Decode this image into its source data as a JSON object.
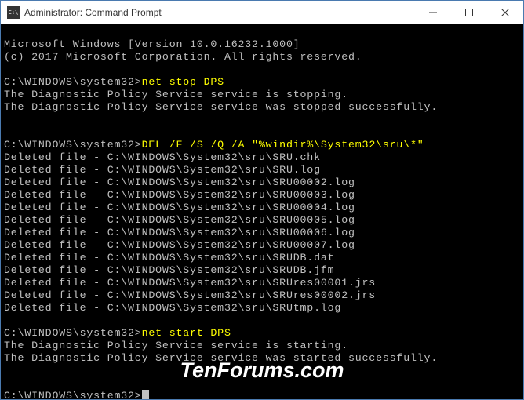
{
  "window": {
    "title": "Administrator: Command Prompt"
  },
  "console": {
    "header1": "Microsoft Windows [Version 10.0.16232.1000]",
    "header2": "(c) 2017 Microsoft Corporation. All rights reserved.",
    "prompt": "C:\\WINDOWS\\system32>",
    "cmd1": "net stop DPS",
    "out1a": "The Diagnostic Policy Service service is stopping.",
    "out1b": "The Diagnostic Policy Service service was stopped successfully.",
    "cmd2": "DEL /F /S /Q /A \"%windir%\\System32\\sru\\*\"",
    "del_prefix": "Deleted file - C:\\WINDOWS\\System32\\sru\\",
    "del_files": [
      "SRU.chk",
      "SRU.log",
      "SRU00002.log",
      "SRU00003.log",
      "SRU00004.log",
      "SRU00005.log",
      "SRU00006.log",
      "SRU00007.log",
      "SRUDB.dat",
      "SRUDB.jfm",
      "SRUres00001.jrs",
      "SRUres00002.jrs",
      "SRUtmp.log"
    ],
    "cmd3": "net start DPS",
    "out3a": "The Diagnostic Policy Service service is starting.",
    "out3b": "The Diagnostic Policy Service service was started successfully."
  },
  "watermark": "TenForums.com"
}
